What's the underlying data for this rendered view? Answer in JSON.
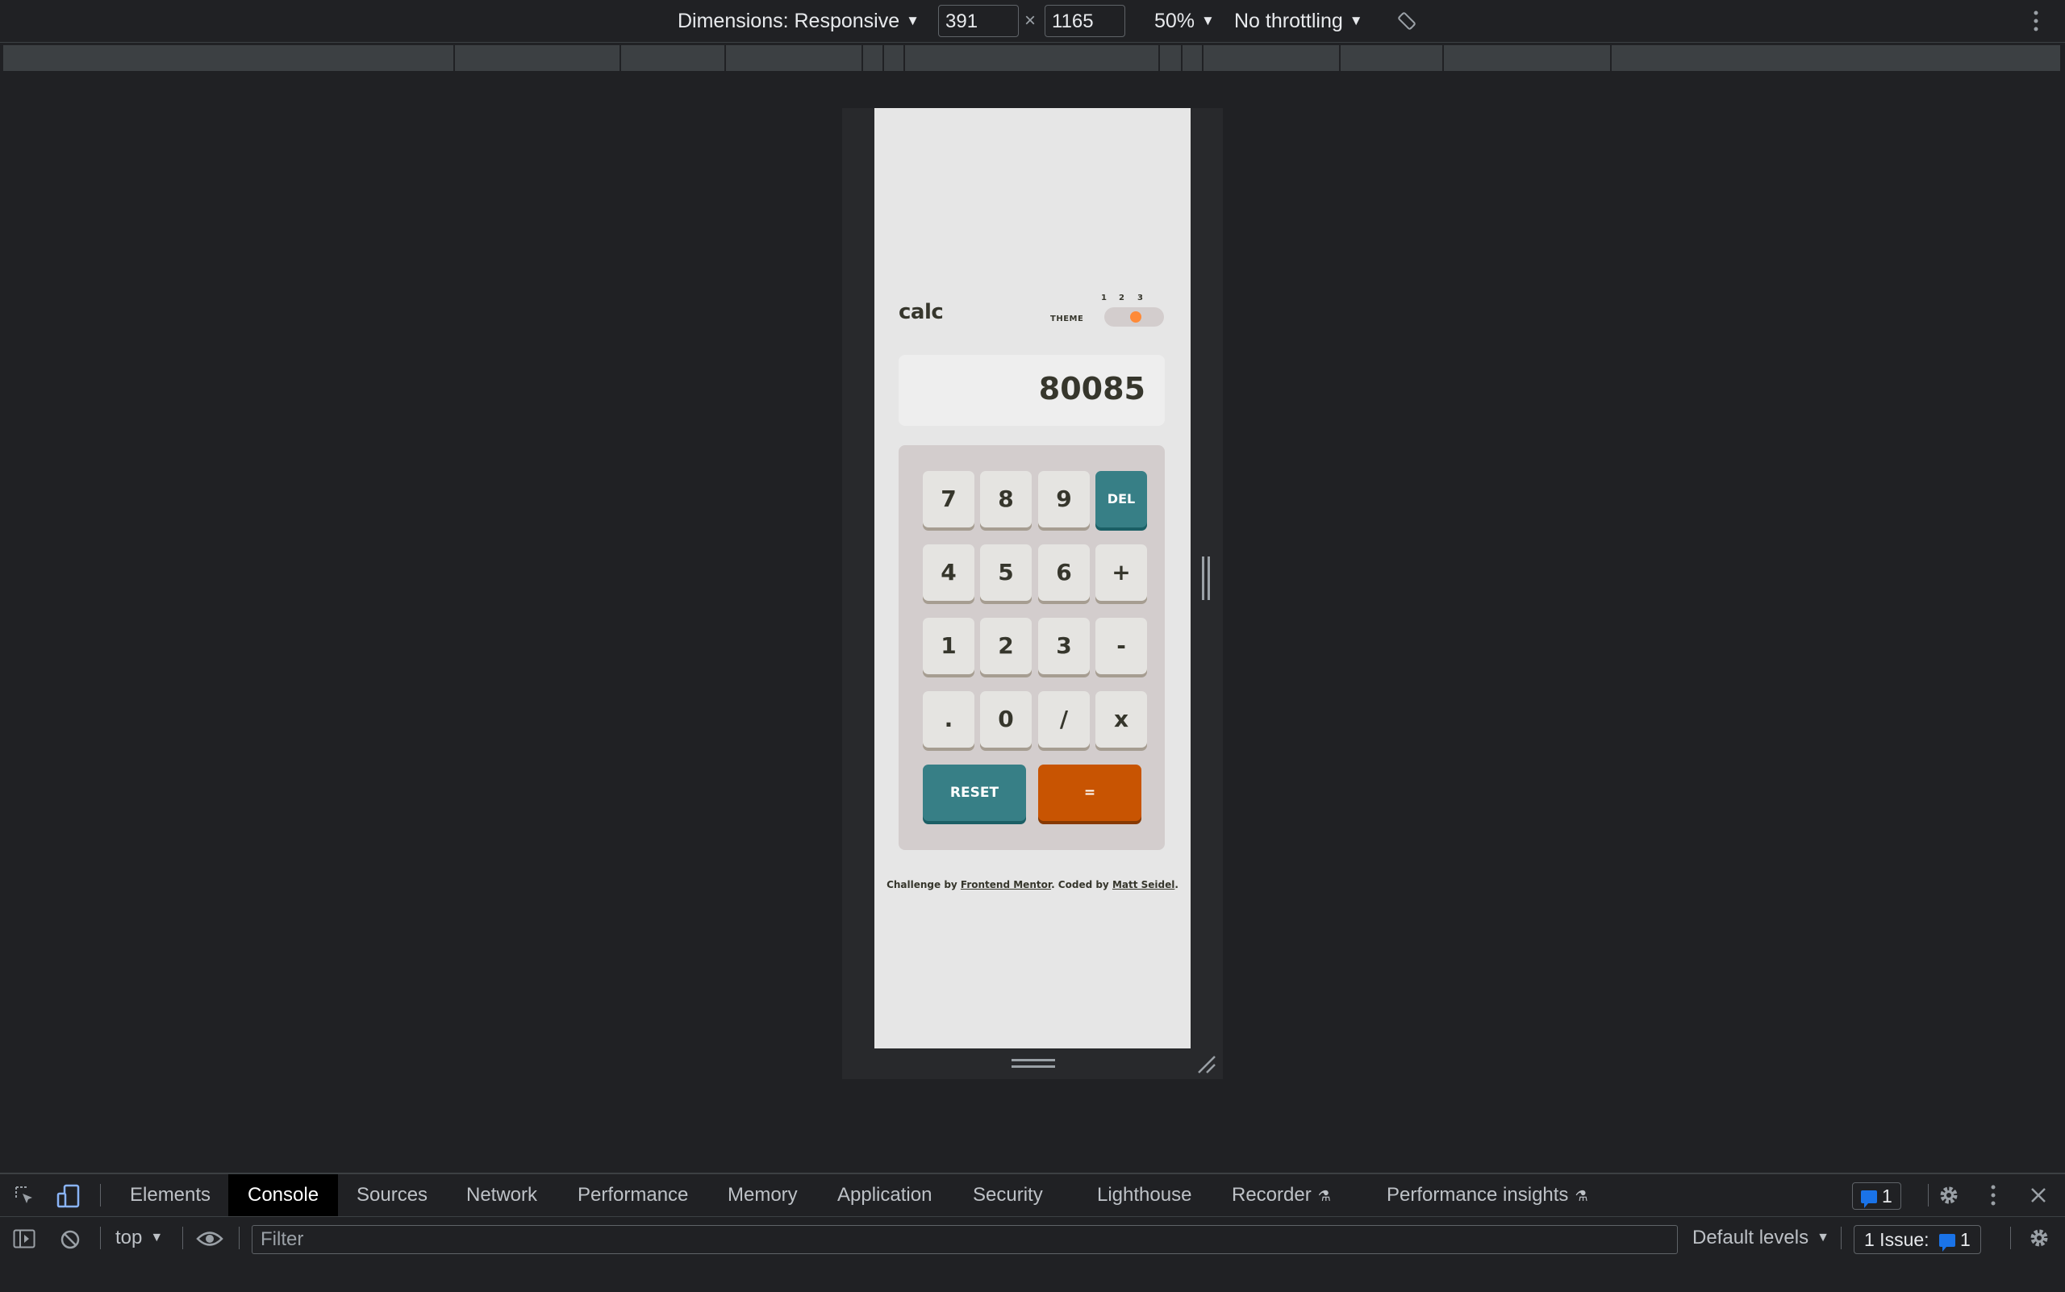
{
  "device_toolbar": {
    "dimensions_label": "Dimensions: Responsive",
    "width": "391",
    "height": "1165",
    "times": "×",
    "zoom": "50%",
    "throttling": "No throttling"
  },
  "app": {
    "title": "calc",
    "theme_label": "THEME",
    "theme_options": [
      "1",
      "2",
      "3"
    ],
    "selected_theme": "2",
    "display": "80085",
    "keys": [
      "7",
      "8",
      "9",
      "DEL",
      "4",
      "5",
      "6",
      "+",
      "1",
      "2",
      "3",
      "-",
      ".",
      "0",
      "/",
      "x"
    ],
    "reset_label": "RESET",
    "equals_label": "=",
    "attribution": {
      "prefix": "Challenge by ",
      "link1": "Frontend Mentor",
      "middle": ". Coded by ",
      "link2": "Matt Seidel",
      "suffix": "."
    },
    "colors": {
      "background": "#e6e6e6",
      "keypad": "#d3cdcd",
      "accent_teal": "#377f86",
      "accent_orange": "#c85402",
      "toggle_knob": "#ff8a38"
    }
  },
  "devtools": {
    "tabs": [
      "Elements",
      "Console",
      "Sources",
      "Network",
      "Performance",
      "Memory",
      "Application",
      "Security",
      "Lighthouse",
      "Recorder",
      "Performance insights"
    ],
    "active_tab": "Console",
    "message_count": "1",
    "context": "top",
    "filter_placeholder": "Filter",
    "levels": "Default levels",
    "issues_label": "1 Issue:",
    "issues_count": "1"
  }
}
